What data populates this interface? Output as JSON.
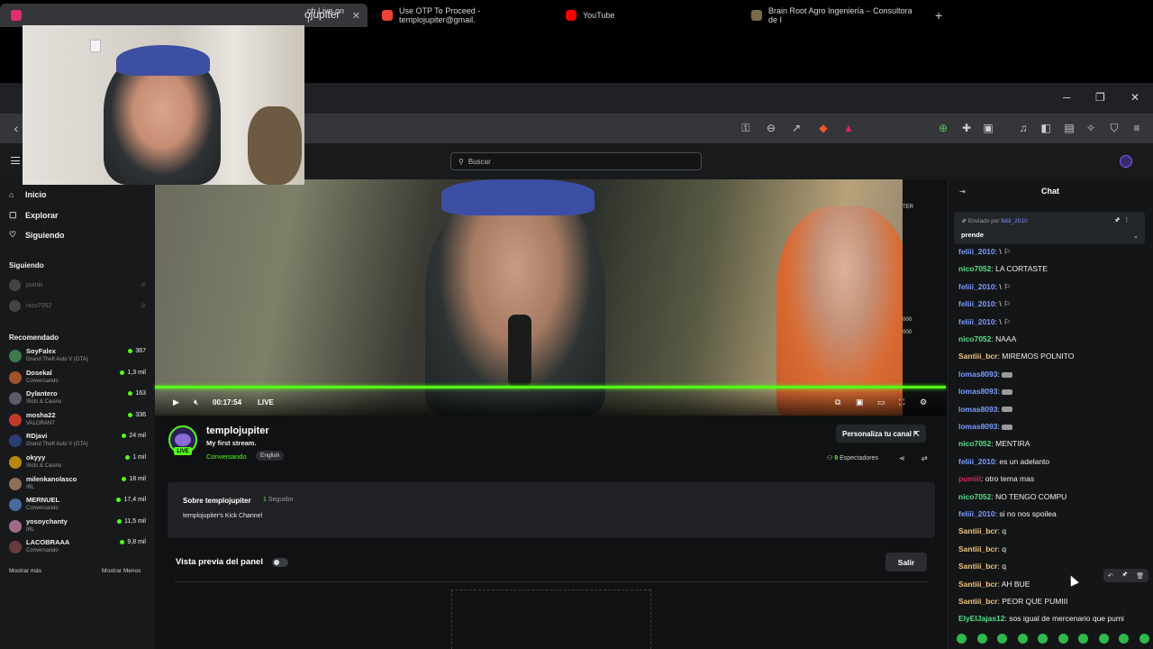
{
  "browser": {
    "tabs": [
      {
        "label": "ch Live on I",
        "icon": "kick-favicon",
        "color": "#53fc18",
        "active": true
      },
      {
        "label": "Use OTP To Proceed - templojupiter@gmail.",
        "icon": "gmail-icon",
        "color": "#ea4335"
      },
      {
        "label": "YouTube",
        "icon": "youtube-icon",
        "color": "#ff0000"
      },
      {
        "label": "Brain Root Agro Ingeniería – Consultora de I",
        "icon": "site-icon",
        "color": "#7a6a4a"
      }
    ],
    "new_tab": "+",
    "address": "ojupiter",
    "window_controls": {
      "minimize": "─",
      "maximize": "❐",
      "close": "✕"
    }
  },
  "kick": {
    "search_placeholder": "Buscar",
    "nav": [
      {
        "label": "Inicio",
        "icon": "home-icon"
      },
      {
        "label": "Explorar",
        "icon": "compass-icon"
      },
      {
        "label": "Siguiendo",
        "icon": "heart-icon"
      }
    ],
    "following_title": "Siguiendo",
    "following": [
      {
        "name": "pumiii"
      },
      {
        "name": "nico7052"
      }
    ],
    "recommended_title": "Recomendado",
    "recommended": [
      {
        "name": "SoyFalex",
        "category": "Grand Theft Auto V (GTA)",
        "viewers": "367",
        "color": "#3b7a4a"
      },
      {
        "name": "Dosekal",
        "category": "Conversando",
        "viewers": "1,3 mil",
        "color": "#a0522d"
      },
      {
        "name": "Dylantero",
        "category": "Slots & Casino",
        "viewers": "163",
        "color": "#5a5a6a"
      },
      {
        "name": "mosha22",
        "category": "VALORANT",
        "viewers": "336",
        "color": "#c0392b"
      },
      {
        "name": "RDjavi",
        "category": "Grand Theft Auto V (GTA)",
        "viewers": "24 mil",
        "color": "#2c3e70"
      },
      {
        "name": "okyyy",
        "category": "Slots & Casino",
        "viewers": "1 mil",
        "color": "#b8860b"
      },
      {
        "name": "milenkanolasco",
        "category": "IRL",
        "viewers": "18 mil",
        "color": "#8b6f5a"
      },
      {
        "name": "MERNUEL",
        "category": "Conversando",
        "viewers": "17,4 mil",
        "color": "#4a6a9a"
      },
      {
        "name": "yosoychanty",
        "category": "IRL",
        "viewers": "11,5 mil",
        "color": "#a06a8a"
      },
      {
        "name": "LACOBRAAA",
        "category": "Conversando",
        "viewers": "9,8 mil",
        "color": "#6a3a3a"
      }
    ],
    "show_more": "Mostrar más",
    "show_less": "Mostrar Menos",
    "player": {
      "time": "00:17:54",
      "live_label": "LIVE",
      "side_tag_top": "TER",
      "side_tag_mid1": "000",
      "side_tag_mid2": "000"
    },
    "channel": {
      "name": "templojupiter",
      "title": "My first stream.",
      "category": "Conversando",
      "language": "English",
      "live_badge": "LIVE",
      "customize_label": "Personaliza tu canal ⇱",
      "viewers_count": "9",
      "viewers_label": "Espectadores"
    },
    "about": {
      "title": "Sobre templojupiter",
      "followers_count": "1",
      "followers_label": "Seguidor",
      "description": "templojupiter's Kick Channel"
    },
    "panel": {
      "title": "Vista previa del panel",
      "exit_label": "Salir"
    }
  },
  "chat": {
    "header": "Chat",
    "pinned_by_label": "Enviado por",
    "pinned_by_user": "feliii_2010",
    "pinned_message": "prende",
    "messages": [
      {
        "user": "feliii_2010",
        "color": "#7b9cff",
        "text": "",
        "emote": "wave"
      },
      {
        "user": "nico7052",
        "color": "#53e08a",
        "text": "LA CORTASTE"
      },
      {
        "user": "feliii_2010",
        "color": "#7b9cff",
        "text": "",
        "emote": "wave"
      },
      {
        "user": "feliii_2010",
        "color": "#7b9cff",
        "text": "",
        "emote": "wave"
      },
      {
        "user": "feliii_2010",
        "color": "#7b9cff",
        "text": "",
        "emote": "wave"
      },
      {
        "user": "nico7052",
        "color": "#53e08a",
        "text": "NAAA"
      },
      {
        "user": "Santiii_bcr",
        "color": "#f2c57c",
        "text": "MIREMOS POLNITO"
      },
      {
        "user": "lomas8093",
        "color": "#7b9cff",
        "text": "",
        "emote": "bar"
      },
      {
        "user": "lomas8093",
        "color": "#7b9cff",
        "text": "",
        "emote": "bar"
      },
      {
        "user": "lomas8093",
        "color": "#7b9cff",
        "text": "",
        "emote": "bar"
      },
      {
        "user": "lomas8093",
        "color": "#7b9cff",
        "text": "",
        "emote": "bar"
      },
      {
        "user": "nico7052",
        "color": "#53e08a",
        "text": "MENTIRA"
      },
      {
        "user": "feliii_2010",
        "color": "#7b9cff",
        "text": "es un adelanto"
      },
      {
        "user": "pumiii",
        "color": "#e0245e",
        "text": "otro tema mas"
      },
      {
        "user": "nico7052",
        "color": "#53e08a",
        "text": "NO TENGO COMPU"
      },
      {
        "user": "feliii_2010",
        "color": "#7b9cff",
        "text": "si no nos spoilea"
      },
      {
        "user": "Santiii_bcr",
        "color": "#f2c57c",
        "text": "q"
      },
      {
        "user": "Santiii_bcr",
        "color": "#f2c57c",
        "text": "q"
      },
      {
        "user": "Santiii_bcr",
        "color": "#f2c57c",
        "text": "q"
      },
      {
        "user": "Santiii_bcr",
        "color": "#f2c57c",
        "text": "AH BUE"
      },
      {
        "user": "Santiii_bcr",
        "color": "#f2c57c",
        "text": "PEOR QUE PUMIII"
      },
      {
        "user": "ElyElJajas12",
        "color": "#53e08a",
        "text": "sos igual de mercenario que pumi"
      }
    ]
  }
}
